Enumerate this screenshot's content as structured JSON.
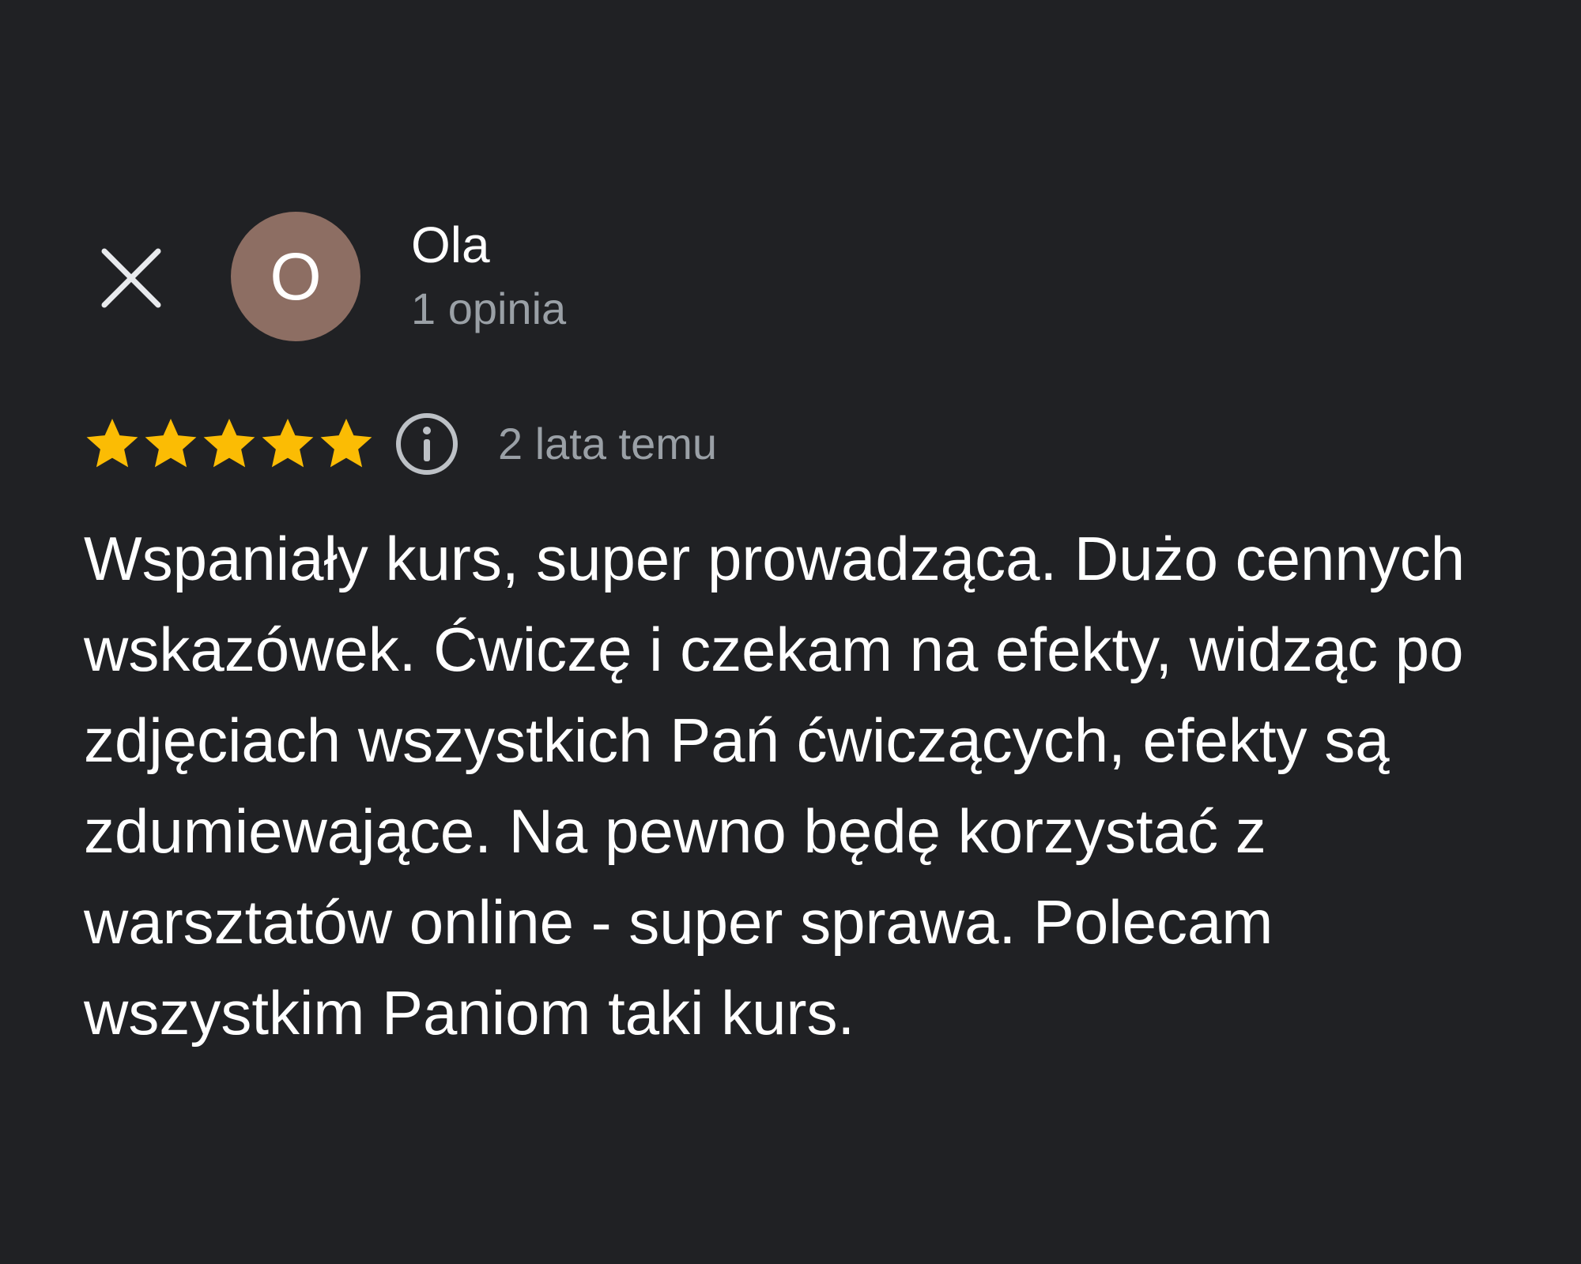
{
  "review": {
    "author": {
      "name": "Ola",
      "initial": "O",
      "review_count": "1 opinia",
      "avatar_color": "#8d6e63"
    },
    "rating": {
      "stars": 5,
      "max": 5,
      "star_color": "#fbbc04"
    },
    "date": "2 lata temu",
    "text": "Wspaniały kurs, super prowadząca. Dużo cennych wskazówek. Ćwiczę i czekam na efekty, widząc po zdjęciach wszystkich Pań ćwiczących, efekty są zdumiewające. Na pewno będę korzystać z warsztatów online - super sprawa. Polecam wszystkim Paniom taki kurs."
  },
  "icons": {
    "close": "close-icon",
    "info": "info-icon",
    "star": "star-icon"
  },
  "colors": {
    "background": "#202124",
    "primary_text": "#ffffff",
    "secondary_text": "#9aa0a6",
    "icon": "#e8eaed"
  }
}
